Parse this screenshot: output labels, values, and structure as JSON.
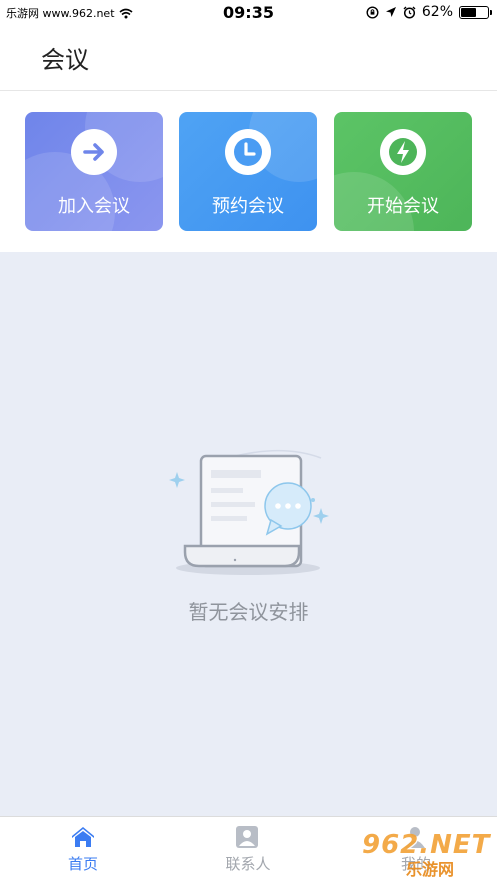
{
  "status_bar": {
    "carrier": "乐游网 www.962.net",
    "time": "09:35",
    "battery": "62%",
    "battery_level": 0.62
  },
  "header": {
    "title": "会议"
  },
  "actions": [
    {
      "label": "加入会议",
      "icon": "arrow-right-icon"
    },
    {
      "label": "预约会议",
      "icon": "clock-icon"
    },
    {
      "label": "开始会议",
      "icon": "lightning-icon"
    }
  ],
  "empty_state": {
    "text": "暂无会议安排",
    "icon": "empty-document-chat-icon"
  },
  "tabbar": {
    "items": [
      {
        "label": "首页",
        "icon": "home-icon",
        "active": true
      },
      {
        "label": "联系人",
        "icon": "contact-icon",
        "active": false
      },
      {
        "label": "我的",
        "icon": "person-icon",
        "active": false
      }
    ]
  },
  "watermark": {
    "line1": "962.NET",
    "line2": "乐游网"
  },
  "colors": {
    "accent": "#3b7cf2",
    "join": "#7b8cec",
    "book": "#4a9cf3",
    "start": "#55bd60",
    "background": "#e9edf6"
  }
}
